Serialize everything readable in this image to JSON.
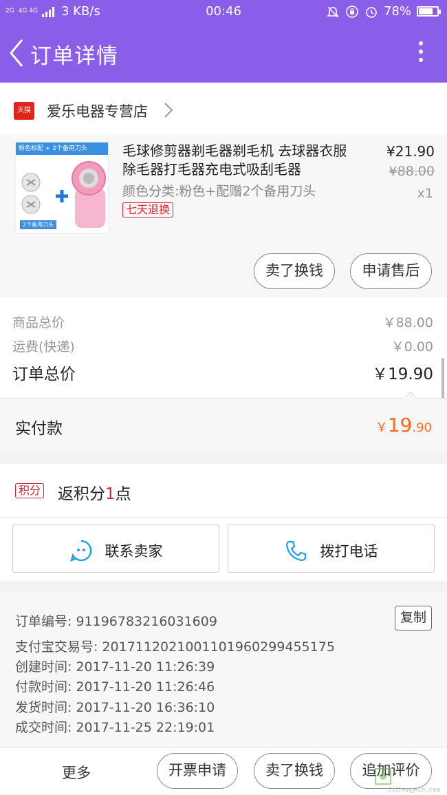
{
  "status_bar": {
    "network": "2G",
    "network2": "4G 4G",
    "speed": "3 KB/s",
    "time": "00:46",
    "battery": "78%",
    "battery_level": 0.78
  },
  "header": {
    "title": "订单详情"
  },
  "store": {
    "badge": "天猫",
    "name": "爱乐电器专营店"
  },
  "product": {
    "image_tag": "粉色标配 + 2个备用刀头",
    "image_note": "2个备用刀头",
    "title": "毛球修剪器剃毛器剃毛机 去球器衣服除毛器打毛器充电式吸刮毛器",
    "variant": "颜色分类:粉色+配赠2个备用刀头",
    "return_badge": "七天退换",
    "price": "¥21.90",
    "original_price": "¥88.00",
    "quantity": "x1",
    "actions": [
      "卖了换钱",
      "申请售后"
    ]
  },
  "totals": [
    {
      "label": "商品总价",
      "value": "￥88.00"
    },
    {
      "label": "运费(快递)",
      "value": "￥0.00"
    },
    {
      "label": "订单总价",
      "value": "￥19.90"
    }
  ],
  "paid": {
    "label": "实付款",
    "currency": "￥",
    "int": "19",
    "dec": ".90",
    "color": "#ff6a1a"
  },
  "points": {
    "badge": "积分",
    "prefix": "返积分",
    "num": "1",
    "suffix": "点"
  },
  "contact": {
    "seller": "联系卖家",
    "phone": "拨打电话"
  },
  "order_info": {
    "copy": "复制",
    "lines": [
      "订单编号: 91196783216031609",
      "支付宝交易号: 2017112021001101960299455175",
      "创建时间: 2017-11-20 11:26:39",
      "付款时间: 2017-11-20 11:26:46",
      "发货时间: 2017-11-20 16:36:10",
      "成交时间: 2017-11-25 22:19:01"
    ]
  },
  "bottom_bar": {
    "more": "更多",
    "buttons": [
      "开票申请",
      "卖了换钱",
      "追加评价"
    ],
    "watermark_url": "JiChengXin.com"
  },
  "colors": {
    "accent": "#8a5ee8",
    "price_red": "#d8262e",
    "paid_orange": "#ff6a1a"
  }
}
